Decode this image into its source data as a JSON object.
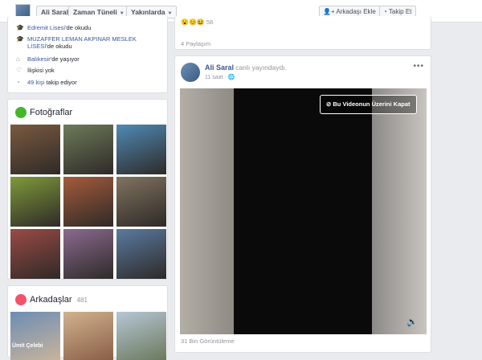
{
  "topbar": {
    "profile_name": "Ali Saral",
    "timeline_label": "Zaman Tüneli",
    "about_label": "Yakınlarda",
    "add_friend_label": "Arkadaşı Ekle",
    "follow_label": "Takip Et"
  },
  "intro": {
    "school1_name": "Edremit Lisesi",
    "school1_suffix": "'de okudu",
    "school2_name_line1": "MUZAFFER LEMAN AKPINAR MESLEK",
    "school2_name_line2": "LİSESİ",
    "school2_suffix": "'de okudu",
    "city_name": "Balıkesir",
    "city_suffix": "'de yaşıyor",
    "relationship": "İlişkisi yok",
    "followers_count": "49 kişi",
    "followers_suffix": "takip ediyor"
  },
  "top_post": {
    "shares": "4 Paylaşım",
    "reaction_count": "58"
  },
  "photos": {
    "title": "Fotoğraflar",
    "colors": [
      "#7a5a40",
      "#6e7a5a",
      "#4f8ab5",
      "#7f9a3a",
      "#a55b3b",
      "#807360",
      "#9a4a45",
      "#8a6a90",
      "#5a7aa0"
    ]
  },
  "friends": {
    "title": "Arkadaşlar",
    "count": "481",
    "first_name_partial": "Ümit Çelebi"
  },
  "post": {
    "author": "Ali Saral",
    "action": "canlı yayındaydı.",
    "time": "11 saat",
    "hide_video_label": "Bu Videonun Üzerini Kapat",
    "views": "31 Bin Görüntüleme"
  },
  "icons": {
    "school": "graduation-cap-icon",
    "home": "home-icon",
    "heart": "heart-icon",
    "rss": "rss-icon"
  },
  "colors": {
    "link": "#365899",
    "photos_icon": "#42b72a",
    "friends_icon": "#f35369"
  }
}
